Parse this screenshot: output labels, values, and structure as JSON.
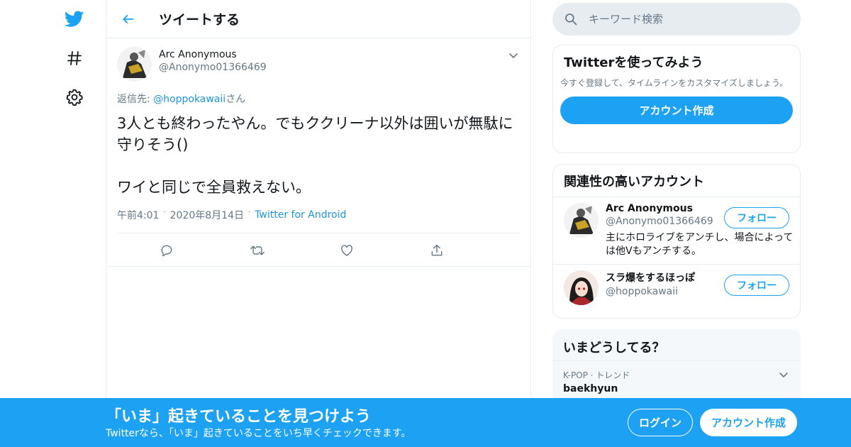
{
  "header": {
    "title": "ツイートする"
  },
  "tweet": {
    "author_name": "Arc Anonymous",
    "author_handle": "@Anonymo01366469",
    "reply_prefix": "返信先: ",
    "reply_to": "@hoppokawaii",
    "reply_suffix": "さん",
    "text": "3人とも終わったやん。でもククリーナ以外は囲いが無駄に守りそう()\n\nワイと同じで全員救えない。",
    "time": "午前4:01",
    "date": "2020年8月14日",
    "source": "Twitter for Android"
  },
  "search": {
    "placeholder": "キーワード検索"
  },
  "signup_card": {
    "title": "Twitterを使ってみよう",
    "description": "今すぐ登録して、タイムラインをカスタマイズしましょう。",
    "button": "アカウント作成"
  },
  "related": {
    "title": "関連性の高いアカウント",
    "users": [
      {
        "name": "Arc Anonymous",
        "handle": "@Anonymo01366469",
        "bio": "主にホロライブをアンチし、場合によっては他Vもアンチする。",
        "follow": "フォロー"
      },
      {
        "name": "スラ爆をするほっぽ",
        "handle": "@hoppokawaii",
        "bio": "",
        "follow": "フォロー"
      }
    ]
  },
  "trends": {
    "title": "いまどうしてる？",
    "items": [
      {
        "meta": "K-POP · トレンド",
        "name": "baekhyun"
      }
    ]
  },
  "bottom_bar": {
    "title": "「いま」起きていることを見つけよう",
    "subtitle": "Twitterなら、「いま」起きていることをいち早くチェックできます。",
    "login": "ログイン",
    "signup": "アカウント作成"
  },
  "colors": {
    "brand": "#1da1f2",
    "link": "#1b95e0",
    "secondary_text": "#657786",
    "border": "#e6ecf0"
  },
  "icons": [
    "twitter-logo-icon",
    "hashtag-icon",
    "gear-icon",
    "back-arrow-icon",
    "chevron-down-icon",
    "reply-icon",
    "retweet-icon",
    "like-icon",
    "share-icon",
    "search-icon"
  ]
}
